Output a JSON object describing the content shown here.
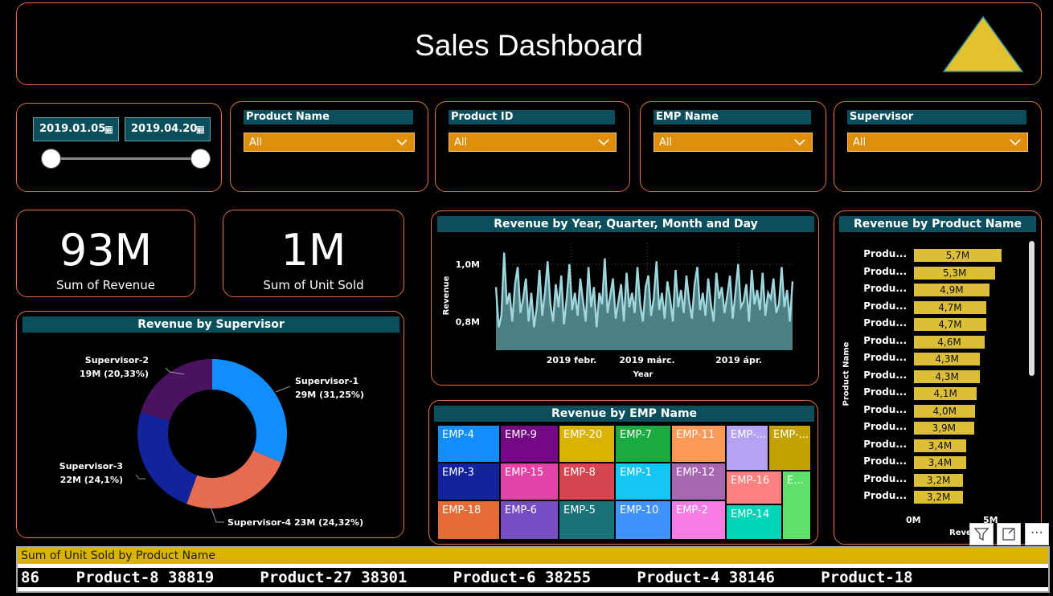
{
  "header": {
    "title": "Sales Dashboard",
    "accent": "#e2c231"
  },
  "date_slicer": {
    "start": "2019.01.05.",
    "end": "2019.04.20."
  },
  "slicers": [
    {
      "label": "Product Name",
      "value": "All"
    },
    {
      "label": "Product ID",
      "value": "All"
    },
    {
      "label": "EMP Name",
      "value": "All"
    },
    {
      "label": "Supervisor",
      "value": "All"
    }
  ],
  "kpis": [
    {
      "value": "93M",
      "label": "Sum of Revenue"
    },
    {
      "value": "1M",
      "label": "Sum of Unit Sold"
    }
  ],
  "supervisor_chart": {
    "title": "Revenue by Supervisor",
    "chart_data": {
      "type": "pie",
      "series": [
        {
          "name": "Supervisor-1",
          "label": "29M (31,25%)",
          "value": 31.25,
          "color": "#118dff"
        },
        {
          "name": "Supervisor-4",
          "label": "23M (24,32%)",
          "value": 24.32,
          "color": "#e66c51"
        },
        {
          "name": "Supervisor-3",
          "label": "22M (24,1%)",
          "value": 24.1,
          "color": "#12239e"
        },
        {
          "name": "Supervisor-2",
          "label": "19M (20,33%)",
          "value": 20.33,
          "color": "#4a135f"
        }
      ]
    }
  },
  "line_chart": {
    "title": "Revenue by Year, Quarter, Month and Day",
    "chart_data": {
      "type": "area",
      "xlabel": "Year",
      "ylabel": "Revenue",
      "yticks": [
        "1,0M",
        "0,8M"
      ],
      "xticks": [
        "2019 febr.",
        "2019 márc.",
        "2019 ápr."
      ],
      "ylim": [
        0.7,
        1.05
      ],
      "values": [
        0.92,
        0.78,
        0.82,
        1.04,
        0.86,
        0.9,
        0.8,
        0.93,
        0.99,
        0.83,
        0.88,
        0.95,
        0.8,
        0.9,
        0.78,
        0.85,
        0.98,
        0.82,
        0.9,
        1.01,
        0.86,
        0.8,
        0.93,
        0.85,
        0.96,
        0.79,
        0.88,
        1.0,
        0.84,
        0.9,
        0.82,
        0.95,
        0.87,
        0.8,
        0.99,
        0.85,
        0.92,
        0.78,
        0.9,
        0.86,
        1.02,
        0.83,
        0.89,
        0.95,
        0.81,
        0.87,
        0.93,
        0.8,
        0.97,
        0.85,
        0.9,
        0.83,
        0.99,
        0.86,
        0.8,
        0.92,
        0.96,
        0.82,
        0.88,
        1.01,
        0.84,
        0.9,
        0.81,
        0.94,
        0.88,
        0.8,
        0.98,
        0.85,
        0.91,
        0.83,
        0.96,
        0.87,
        0.81,
        0.93,
        0.99,
        0.84,
        0.9,
        0.82,
        0.95,
        0.86,
        0.8,
        0.97,
        0.88,
        0.92,
        0.83,
        0.89,
        0.96,
        0.81,
        0.9,
        1.0,
        0.85,
        0.87,
        0.93,
        0.8,
        0.98,
        0.86,
        0.91,
        0.84,
        0.97,
        0.82,
        0.9,
        0.88,
        0.95,
        0.83,
        0.86,
        0.99,
        0.85,
        0.91,
        0.8,
        0.94
      ]
    }
  },
  "emp_chart": {
    "title": "Revenue by EMP Name",
    "cells": [
      {
        "label": "EMP-4",
        "color": "#118dff"
      },
      {
        "label": "EMP-9",
        "color": "#750985"
      },
      {
        "label": "EMP-20",
        "color": "#d9b300"
      },
      {
        "label": "EMP-7",
        "color": "#1aab40"
      },
      {
        "label": "EMP-11",
        "color": "#fa9a56"
      },
      {
        "label": "EMP-...",
        "color": "#b3a3f2"
      },
      {
        "label": "EMP-...",
        "color": "#c4a300"
      },
      {
        "label": "EMP-3",
        "color": "#12239e"
      },
      {
        "label": "EMP-15",
        "color": "#e044a7"
      },
      {
        "label": "EMP-8",
        "color": "#d64550"
      },
      {
        "label": "EMP-1",
        "color": "#15c6f4"
      },
      {
        "label": "EMP-12",
        "color": "#a666b0"
      },
      {
        "label": "EMP-16",
        "color": "#fd817e"
      },
      {
        "label": "E...",
        "color": "#60e06a"
      },
      {
        "label": "EMP-18",
        "color": "#e66c37"
      },
      {
        "label": "EMP-6",
        "color": "#744ec2"
      },
      {
        "label": "EMP-5",
        "color": "#197278"
      },
      {
        "label": "EMP-10",
        "color": "#4092ff"
      },
      {
        "label": "EMP-2",
        "color": "#f57ce3"
      },
      {
        "label": "EMP-14",
        "color": "#00d6b7"
      }
    ]
  },
  "product_chart": {
    "title": "Revenue by Product Name",
    "ylabel": "Product Name",
    "xlabel": "Reve",
    "xticks": [
      "0M",
      "5M"
    ],
    "chart_data": {
      "type": "bar",
      "categories": [
        "Produ...",
        "Produ...",
        "Produ...",
        "Produ...",
        "Produ...",
        "Produ...",
        "Produ...",
        "Produ...",
        "Produ...",
        "Produ...",
        "Produ...",
        "Produ...",
        "Produ...",
        "Produ...",
        "Produ..."
      ],
      "values": [
        5.7,
        5.3,
        4.9,
        4.7,
        4.7,
        4.6,
        4.3,
        4.3,
        4.1,
        4.0,
        3.9,
        3.4,
        3.4,
        3.2,
        3.2
      ],
      "labels": [
        "5,7M",
        "5,3M",
        "4,9M",
        "4,7M",
        "4,7M",
        "4,6M",
        "4,3M",
        "4,3M",
        "4,1M",
        "4,0M",
        "3,9M",
        "3,4M",
        "3,4M",
        "3,2M",
        "3,2M"
      ]
    }
  },
  "ticker": {
    "title": "Sum of Unit Sold by Product Name",
    "text": "86    Product-8 38819     Product-27 38301     Product-6 38255     Product-4 38146     Product-18"
  }
}
